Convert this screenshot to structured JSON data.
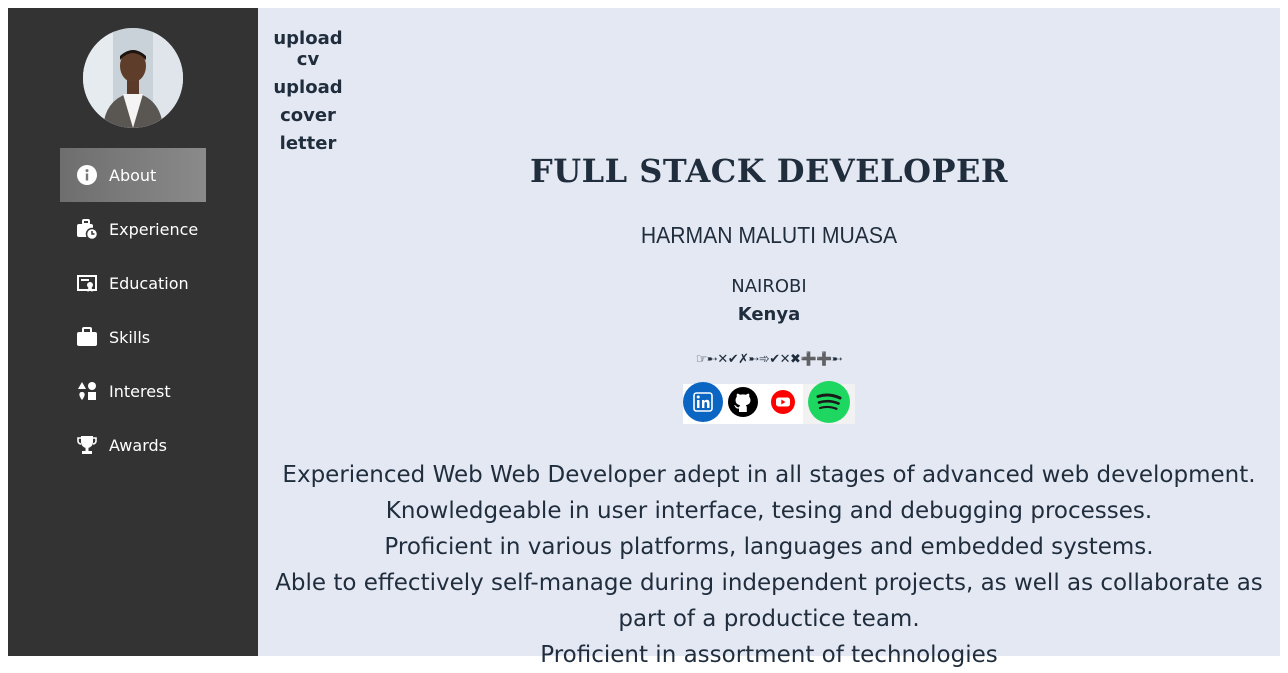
{
  "sidebar": {
    "avatar_alt": "profile photo",
    "items": [
      {
        "label": "About",
        "icon": "info-icon",
        "active": true
      },
      {
        "label": "Experience",
        "icon": "briefcase-clock-icon",
        "active": false
      },
      {
        "label": "Education",
        "icon": "certificate-icon",
        "active": false
      },
      {
        "label": "Skills",
        "icon": "briefcase-icon",
        "active": false
      },
      {
        "label": "Interest",
        "icon": "shapes-icon",
        "active": false
      },
      {
        "label": "Awards",
        "icon": "trophy-icon",
        "active": false
      }
    ]
  },
  "main": {
    "upload_cv": "upload cv",
    "upload_cover_letter": "upload cover letter",
    "job_title": "FULL STACK DEVELOPER",
    "name": "HARMAN MALUTI MUASA",
    "city": "NAIROBI",
    "country": "Kenya",
    "symbols": "☞➸✕✔✗➸➾✔✕✖➕➕➸",
    "socials": [
      {
        "name": "linkedin",
        "icon": "linkedin-icon",
        "color": "#0a66c2"
      },
      {
        "name": "github",
        "icon": "github-icon",
        "color": "#000000"
      },
      {
        "name": "youtube",
        "icon": "youtube-icon",
        "color": "#ff0000"
      },
      {
        "name": "spotify",
        "icon": "spotify-icon",
        "color": "#1ed760"
      }
    ],
    "summary": [
      "Experienced Web Web Developer adept in all stages of advanced web development.",
      "Knowledgeable in user interface, tesing and debugging processes.",
      "Proficient in various platforms, languages and embedded systems.",
      "Able to effectively self-manage during independent projects, as well as collaborate as part of a productice team.",
      "Proficient in assortment of technologies"
    ]
  },
  "colors": {
    "sidebar_bg": "#333333",
    "main_bg": "#e4e8f3",
    "text": "#1f2d3d"
  }
}
